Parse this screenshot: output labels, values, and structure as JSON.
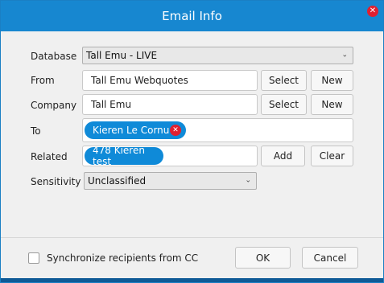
{
  "window": {
    "title": "Email Info",
    "close_icon": "close-icon"
  },
  "form": {
    "database": {
      "label": "Database",
      "value": "Tall Emu - LIVE"
    },
    "from": {
      "label": "From",
      "value": "Tall Emu Webquotes",
      "select_label": "Select",
      "new_label": "New"
    },
    "company": {
      "label": "Company",
      "value": "Tall Emu",
      "select_label": "Select",
      "new_label": "New"
    },
    "to": {
      "label": "To",
      "chips": [
        "Kieren Le Cornu"
      ]
    },
    "related": {
      "label": "Related",
      "chips": [
        "478 Kieren test"
      ],
      "add_label": "Add",
      "clear_label": "Clear"
    },
    "sensitivity": {
      "label": "Sensitivity",
      "value": "Unclassified"
    }
  },
  "footer": {
    "sync_label": "Synchronize recipients from CC",
    "sync_checked": false,
    "ok_label": "OK",
    "cancel_label": "Cancel"
  },
  "colors": {
    "titlebar": "#1787d0",
    "chip": "#0f8ad8",
    "close": "#e02030"
  }
}
